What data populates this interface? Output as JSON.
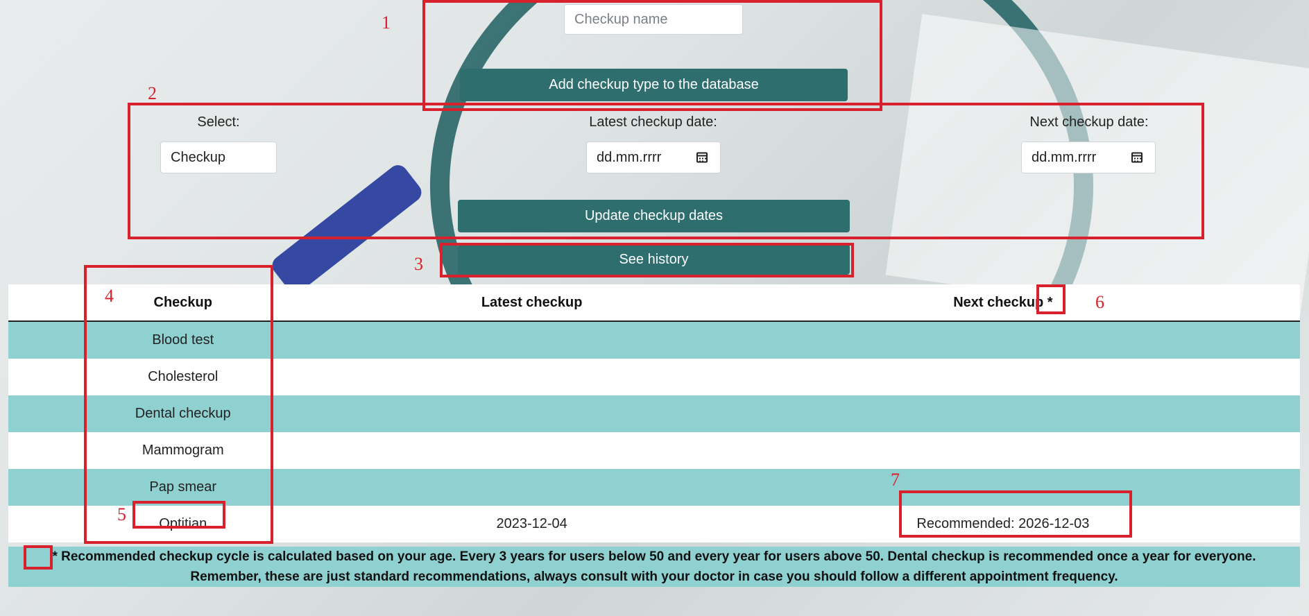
{
  "add_section": {
    "checkup_name_placeholder": "Checkup name",
    "add_button_label": "Add checkup type to the database"
  },
  "update_section": {
    "select_label": "Select:",
    "select_value": "Checkup",
    "latest_label": "Latest checkup date:",
    "latest_placeholder": "dd.mm.rrrr",
    "next_label": "Next checkup date:",
    "next_placeholder": "dd.mm.rrrr",
    "update_button_label": "Update checkup dates"
  },
  "history_button_label": "See history",
  "table": {
    "headers": [
      "Checkup",
      "Latest checkup",
      "Next checkup *"
    ],
    "rows": [
      {
        "checkup": "Blood test",
        "latest": "",
        "next": ""
      },
      {
        "checkup": "Cholesterol",
        "latest": "",
        "next": ""
      },
      {
        "checkup": "Dental checkup",
        "latest": "",
        "next": ""
      },
      {
        "checkup": "Mammogram",
        "latest": "",
        "next": ""
      },
      {
        "checkup": "Pap smear",
        "latest": "",
        "next": ""
      },
      {
        "checkup": "Optitian",
        "latest": "2023-12-04",
        "next": "Recommended: 2026-12-03"
      }
    ]
  },
  "footer_note": {
    "line1": "* Recommended checkup cycle is calculated based on your age. Every 3 years for users below 50 and every year for users above 50. Dental checkup is recommended once a year for everyone.",
    "line2": "Remember, these are just standard recommendations, always consult with your doctor in case you should follow a different appointment frequency."
  },
  "annotation_numbers": [
    "1",
    "2",
    "3",
    "4",
    "5",
    "6",
    "7"
  ],
  "colors": {
    "button": "#2e6e6e",
    "row_highlight": "#8fd1d0",
    "annotation": "#d8212d"
  }
}
